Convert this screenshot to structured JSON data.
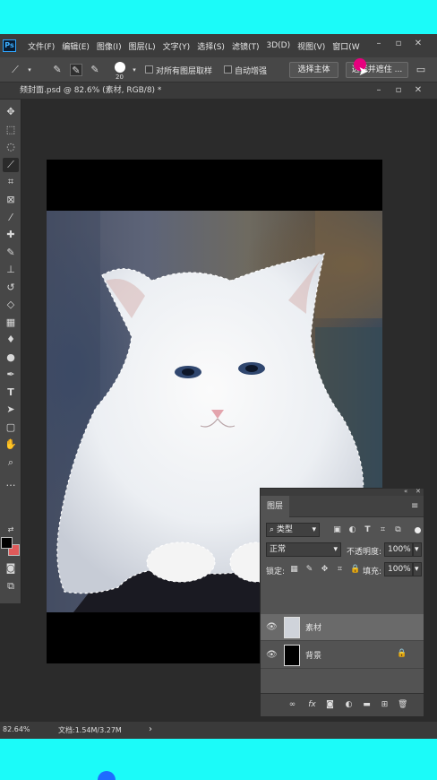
{
  "app": {
    "logo": "Ps"
  },
  "menu": [
    "文件(F)",
    "编辑(E)",
    "图像(I)",
    "图层(L)",
    "文字(Y)",
    "选择(S)",
    "滤镜(T)",
    "3D(D)",
    "视图(V)",
    "窗口(W"
  ],
  "options": {
    "brush_size": "20",
    "sample_all_layers": "对所有图层取样",
    "auto_enhance": "自动增强",
    "select_subject": "选择主体",
    "select_and_mask": "选择并遮住 ..."
  },
  "document": {
    "tab_title": "频封面.psd @ 82.6% (素材, RGB/8) *"
  },
  "status": {
    "zoom": "82.64%",
    "doc_size": "文档:1.54M/3.27M",
    "arrow": "›"
  },
  "layers_panel": {
    "tab": "图层",
    "filter_kind": "类型",
    "blend_mode": "正常",
    "opacity_label": "不透明度:",
    "opacity_value": "100%",
    "lock_label": "锁定:",
    "fill_label": "填充:",
    "fill_value": "100%",
    "layers": [
      {
        "name": "素材",
        "selected": true,
        "visible": true,
        "locked": false
      },
      {
        "name": "背景",
        "selected": false,
        "visible": true,
        "locked": true
      }
    ]
  },
  "colors": {
    "foreground": "#000000",
    "background": "#e05a5a",
    "frame": "#1bfbf9",
    "accent_cursor": "#e6007e"
  }
}
